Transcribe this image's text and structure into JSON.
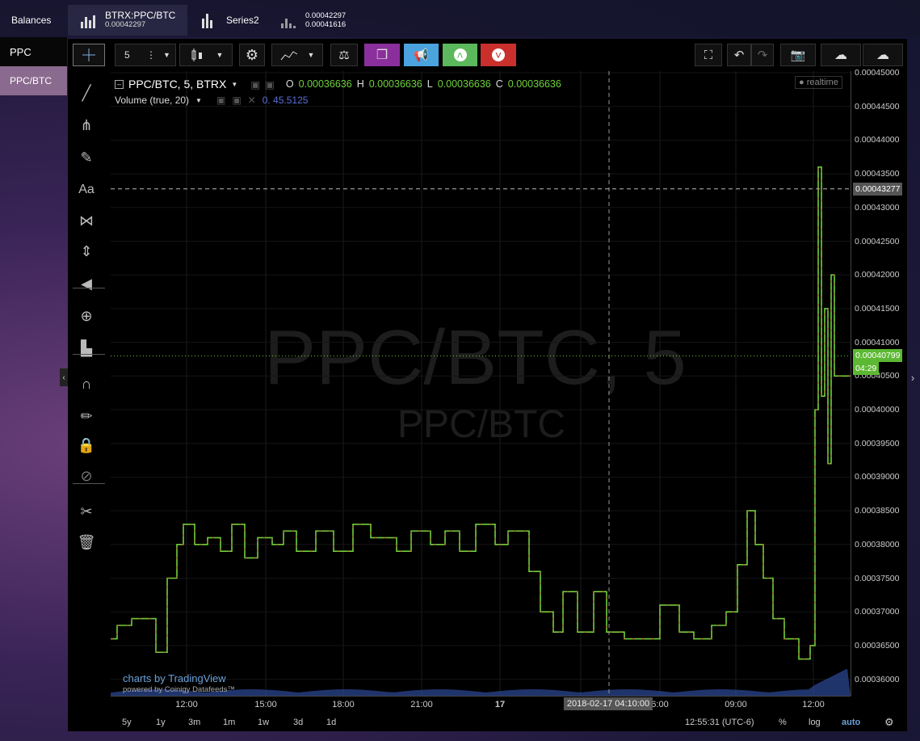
{
  "topbar": {
    "balances": "Balances",
    "pair_tab": {
      "title": "BTRX:PPC/BTC",
      "price": "0.00042297"
    },
    "series_tab": {
      "title": "Series2"
    },
    "bid_ask": {
      "top": "0.00042297",
      "bottom": "0.00041616"
    }
  },
  "left_list": [
    "PPC",
    "PPC/BTC"
  ],
  "toolbar": {
    "interval": "5",
    "colors": {
      "purple": "#8b2f9c",
      "blue": "#4aa3df",
      "green": "#5cb85c",
      "red": "#c9302c"
    }
  },
  "legend": {
    "symbol": "PPC/BTC, 5, BTRX",
    "o_label": "O",
    "o": "0.00036636",
    "h_label": "H",
    "h": "0.00036636",
    "l_label": "L",
    "l": "0.00036636",
    "c_label": "C",
    "c": "0.00036636",
    "volume_label": "Volume (true, 20)",
    "volume_value": "0. 45.5125",
    "realtime": "realtime"
  },
  "watermark": {
    "main": "PPC/BTC, 5",
    "sub": "PPC/BTC"
  },
  "tradingview": {
    "brand": "charts by TradingView",
    "powered": "powered by Coinigy Datafeeds™"
  },
  "price_axis": {
    "ticks": [
      "0.00045000",
      "0.00044500",
      "0.00044000",
      "0.00043500",
      "0.00043000",
      "0.00042500",
      "0.00042000",
      "0.00041500",
      "0.00041000",
      "0.00040500",
      "0.00040000",
      "0.00039500",
      "0.00039000",
      "0.00038500",
      "0.00038000",
      "0.00037500",
      "0.00037000",
      "0.00036500",
      "0.00036000"
    ],
    "crosshair_price": "0.00043277",
    "last_price": "0.00040799",
    "countdown": "04:29"
  },
  "time_axis": {
    "ticks": [
      "12:00",
      "15:00",
      "18:00",
      "21:00",
      "17",
      "09:00",
      "12:00"
    ],
    "crosshair_time": "2018-02-17 04:10:00",
    "after_crosshair": "6:00"
  },
  "bottom": {
    "ranges": [
      "5y",
      "1y",
      "3m",
      "1m",
      "1w",
      "3d",
      "1d"
    ],
    "clock": "12:55:31 (UTC-6)",
    "percent": "%",
    "log": "log",
    "auto": "auto"
  }
}
